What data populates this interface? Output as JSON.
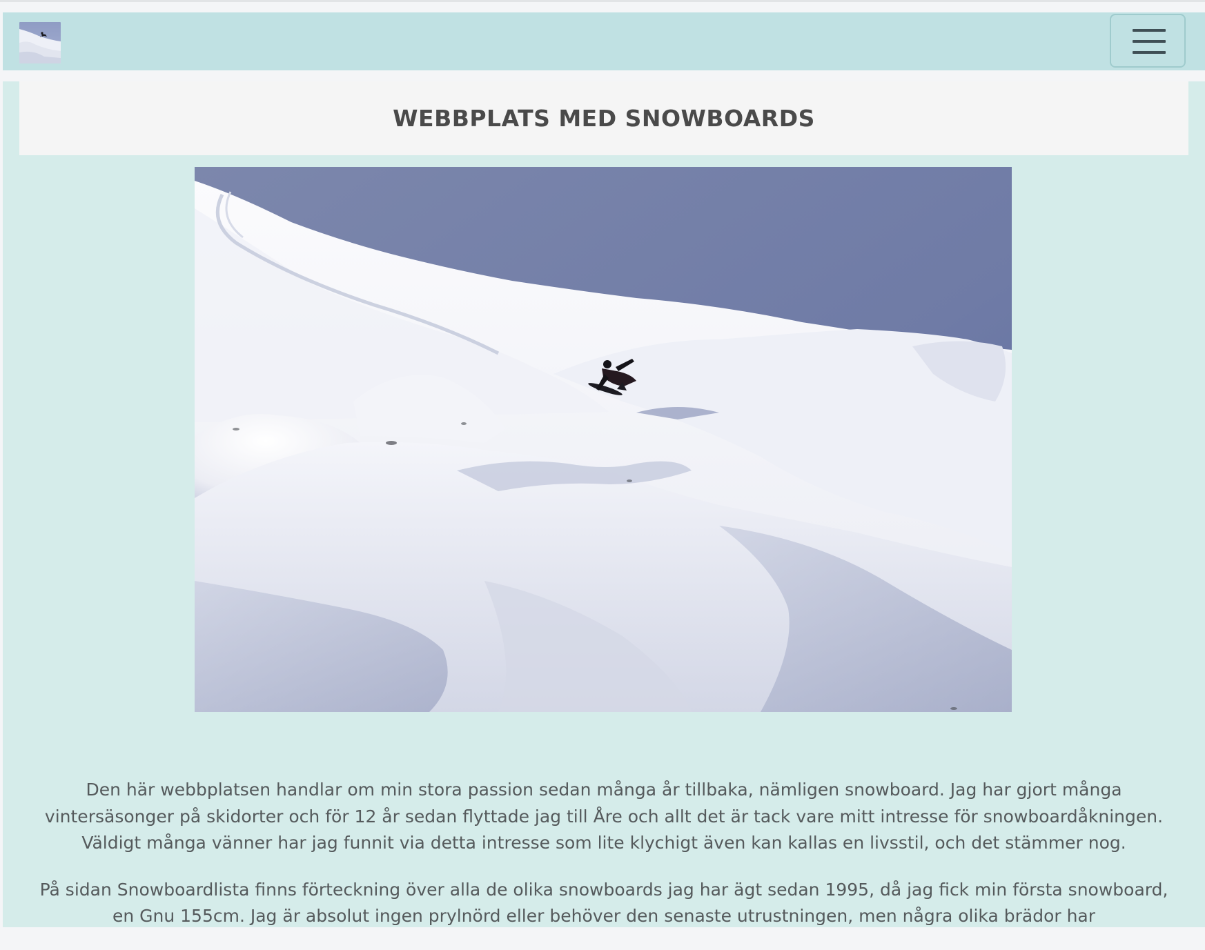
{
  "header": {
    "logo_alt": "snowboard-thumbnail",
    "menu_icon": "hamburger-menu-icon"
  },
  "main": {
    "title": "WEBBPLATS MED SNOWBOARDS",
    "hero_image": "snowboarder-powder-slope",
    "paragraphs": [
      "Den här webbplatsen handlar om min stora passion sedan många år tillbaka, nämligen snowboard. Jag har gjort många vintersäsonger på skidorter och för 12 år sedan flyttade jag till Åre och allt det är tack vare mitt intresse för snowboardåkningen. Väldigt många vänner har jag funnit via detta intresse som lite klychigt även kan kallas en livsstil, och det stämmer nog.",
      "På sidan Snowboardlista finns förteckning över alla de olika snowboards jag har ägt sedan 1995, då jag fick min första snowboard, en Gnu 155cm. Jag är absolut ingen prylnörd eller behöver den senaste utrustningen, men några olika brädor har"
    ]
  },
  "colors": {
    "navbar": "#c0e1e3",
    "page_background": "#d5ecea",
    "title_background": "#f5f5f5",
    "text": "#555a5c"
  }
}
